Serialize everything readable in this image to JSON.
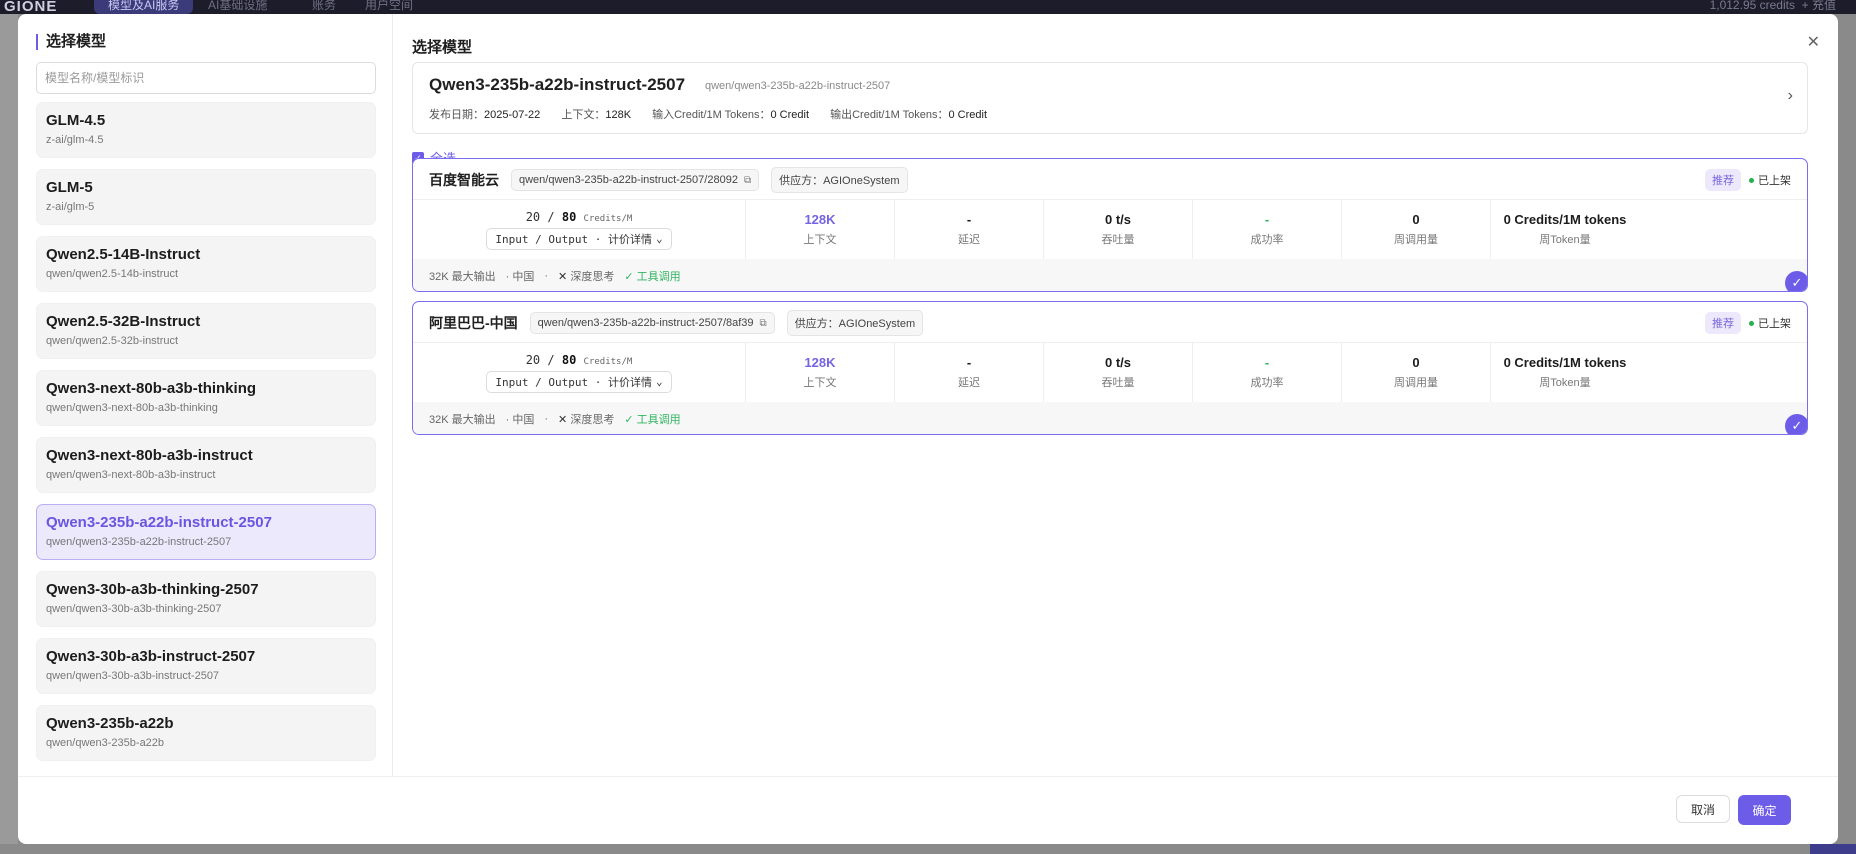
{
  "background": {
    "logo": "GIONE",
    "nav": [
      "模型及AI服务",
      "AI基础设施",
      "账务",
      "用户空间"
    ],
    "balance": "1,012.95",
    "balance_unit": "credits",
    "recharge": "+ 充值"
  },
  "left": {
    "title": "选择模型",
    "search_placeholder": "模型名称/模型标识",
    "models": [
      {
        "name": "GLM-4.5",
        "id": "z-ai/glm-4.5"
      },
      {
        "name": "GLM-5",
        "id": "z-ai/glm-5"
      },
      {
        "name": "Qwen2.5-14B-Instruct",
        "id": "qwen/qwen2.5-14b-instruct"
      },
      {
        "name": "Qwen2.5-32B-Instruct",
        "id": "qwen/qwen2.5-32b-instruct"
      },
      {
        "name": "Qwen3-next-80b-a3b-thinking",
        "id": "qwen/qwen3-next-80b-a3b-thinking"
      },
      {
        "name": "Qwen3-next-80b-a3b-instruct",
        "id": "qwen/qwen3-next-80b-a3b-instruct"
      },
      {
        "name": "Qwen3-235b-a22b-instruct-2507",
        "id": "qwen/qwen3-235b-a22b-instruct-2507",
        "selected": true
      },
      {
        "name": "Qwen3-30b-a3b-thinking-2507",
        "id": "qwen/qwen3-30b-a3b-thinking-2507"
      },
      {
        "name": "Qwen3-30b-a3b-instruct-2507",
        "id": "qwen/qwen3-30b-a3b-instruct-2507"
      },
      {
        "name": "Qwen3-235b-a22b",
        "id": "qwen/qwen3-235b-a22b"
      }
    ]
  },
  "right": {
    "title": "选择模型",
    "info": {
      "name": "Qwen3-235b-a22b-instruct-2507",
      "id": "qwen/qwen3-235b-a22b-instruct-2507",
      "release_label": "发布日期：",
      "release": "2025-07-22",
      "context_label": "上下文：",
      "context": "128K",
      "input_label": "输入Credit/1M Tokens：",
      "input": "0 Credit",
      "output_label": "输出Credit/1M Tokens：",
      "output": "0 Credit"
    },
    "select_all": "全选",
    "providers": [
      {
        "name": "百度智能云",
        "path": "qwen/qwen3-235b-a22b-instruct-2507/28092",
        "supplier": "供应方：AGIOneSystem",
        "recommend": "推荐",
        "status": "已上架",
        "price_in": "20",
        "price_sep": "/",
        "price_out": "80",
        "price_unit": "Credits/M",
        "io_select": "Input / Output · 计价详情",
        "stats": [
          {
            "value": "128K",
            "label": "上下文"
          },
          {
            "value": "-",
            "label": "延迟"
          },
          {
            "value": "0 t/s",
            "label": "吞吐量"
          },
          {
            "value": "-",
            "label": "成功率"
          },
          {
            "value": "0",
            "label": "周调用量"
          },
          {
            "value": "0 Credits/1M tokens",
            "label": "周Token量"
          }
        ],
        "max_output": "32K 最大输出",
        "region": "· 中国",
        "dot": "·",
        "deep_think": "深度思考",
        "tool_call": "工具调用"
      },
      {
        "name": "阿里巴巴-中国",
        "path": "qwen/qwen3-235b-a22b-instruct-2507/8af39",
        "supplier": "供应方：AGIOneSystem",
        "recommend": "推荐",
        "status": "已上架",
        "price_in": "20",
        "price_sep": "/",
        "price_out": "80",
        "price_unit": "Credits/M",
        "io_select": "Input / Output · 计价详情",
        "stats": [
          {
            "value": "128K",
            "label": "上下文"
          },
          {
            "value": "-",
            "label": "延迟"
          },
          {
            "value": "0 t/s",
            "label": "吞吐量"
          },
          {
            "value": "-",
            "label": "成功率"
          },
          {
            "value": "0",
            "label": "周调用量"
          },
          {
            "value": "0 Credits/1M tokens",
            "label": "周Token量"
          }
        ],
        "max_output": "32K 最大输出",
        "region": "· 中国",
        "dot": "·",
        "deep_think": "深度思考",
        "tool_call": "工具调用"
      }
    ]
  },
  "footer": {
    "cancel": "取消",
    "confirm": "确定"
  },
  "colors": {
    "accent": "#6c5ce7",
    "success": "#2fb560"
  }
}
